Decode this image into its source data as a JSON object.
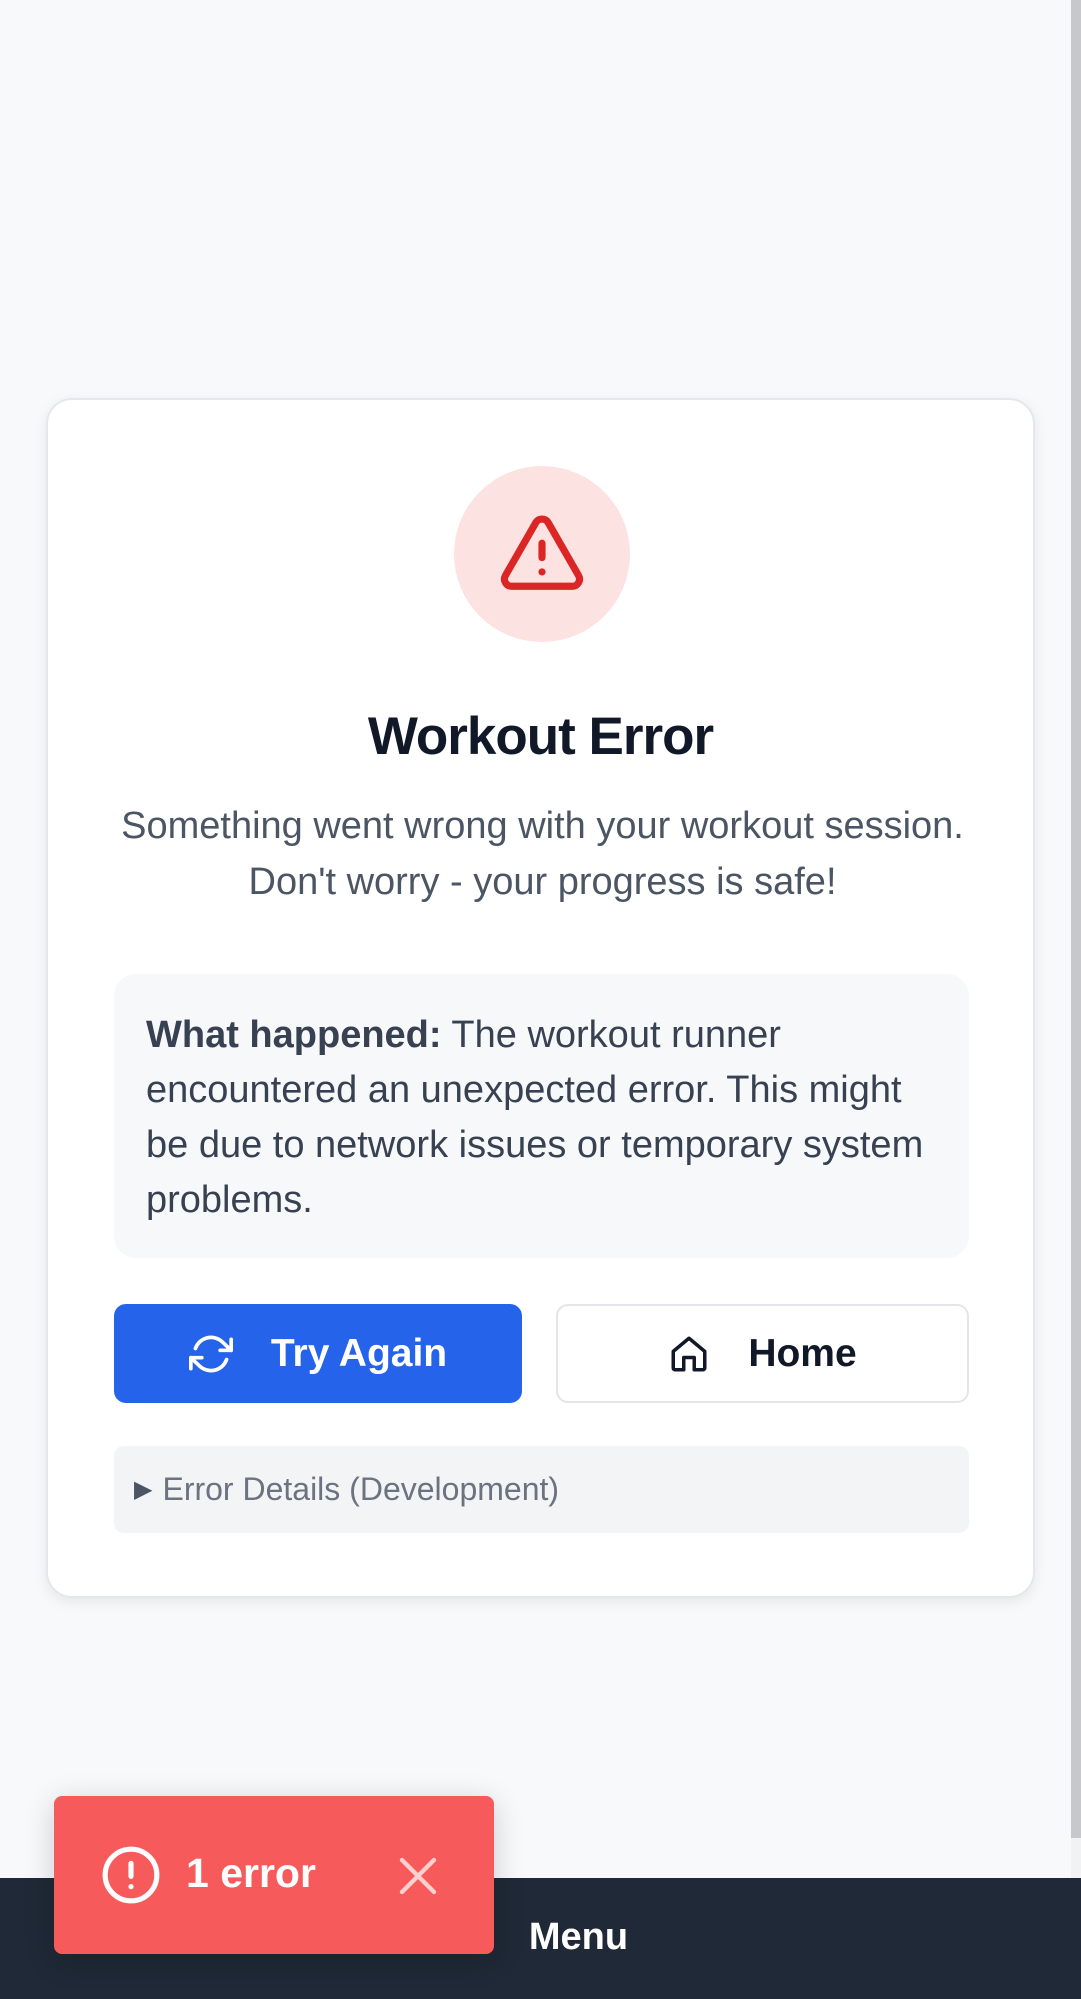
{
  "error_card": {
    "title": "Workout Error",
    "subtitle": "Something went wrong with your workout session. Don't worry - your progress is safe!",
    "info_label": "What happened:",
    "info_text": " The workout runner encountered an unexpected error. This might be due to network issues or temporary system problems.",
    "details_label": "Error Details (Development)",
    "icon": "alert-triangle-icon"
  },
  "actions": {
    "try_again_label": "Try Again",
    "try_again_icon": "refresh-icon",
    "home_label": "Home",
    "home_icon": "home-icon"
  },
  "bottom_bar": {
    "menu_label": "Menu"
  },
  "toast": {
    "text": "1 error",
    "icon": "alert-circle-icon",
    "close_icon": "close-icon"
  },
  "colors": {
    "primary": "#2563eb",
    "danger": "#dc2626",
    "danger_bg": "#fde2e2",
    "toast_bg": "#f75a5a",
    "bottom_bar_bg": "#1f2937"
  }
}
